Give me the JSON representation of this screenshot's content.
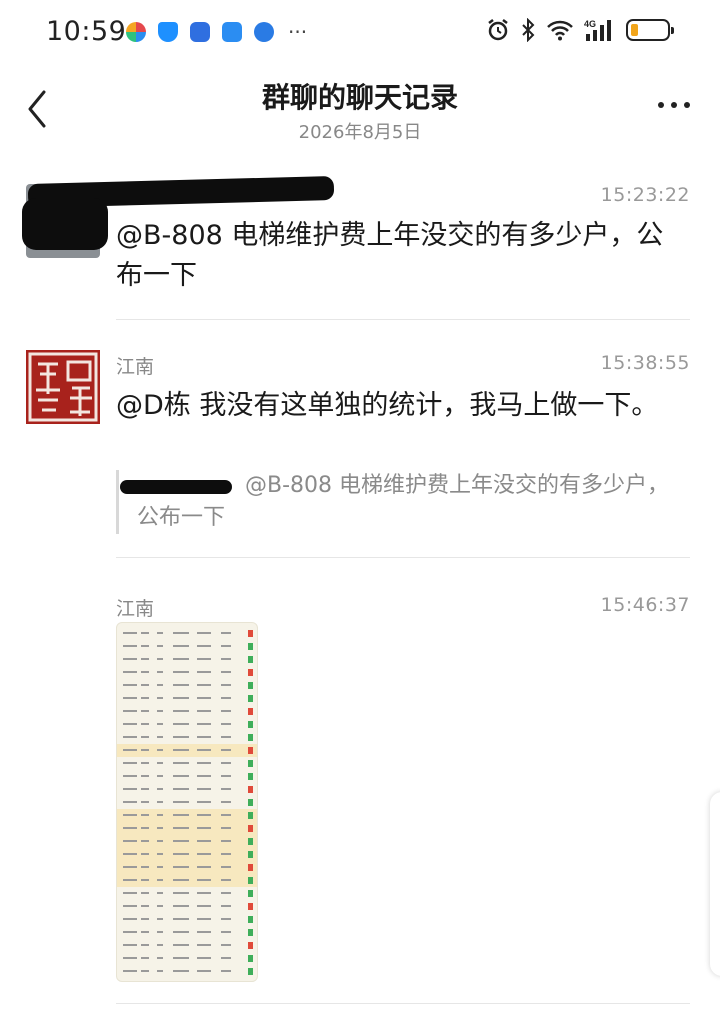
{
  "status_bar": {
    "time": "10:59",
    "network": "4G",
    "battery_level": 0.2,
    "battery_color": "#f2a51a",
    "app_icons": [
      "hex-app-icon",
      "shield-app-icon",
      "phone-app-icon",
      "chat-app-icon",
      "globe-app-icon"
    ],
    "more": "···"
  },
  "header": {
    "title": "群聊的聊天记录",
    "subtitle": "2026年8月5日"
  },
  "messages": [
    {
      "sender": "",
      "time": "15:23:22",
      "text": "@B-808 电梯维护费上年没交的有多少户，公布一下"
    },
    {
      "sender": "江南",
      "time": "15:38:55",
      "text": "@D栋 我没有这单独的统计，我马上做一下。",
      "quote": "@B-808 电梯维护费上年没交的有多少户，公布一下"
    },
    {
      "sender": "江南",
      "time": "15:46:37",
      "attachment": "spreadsheet-image"
    }
  ]
}
